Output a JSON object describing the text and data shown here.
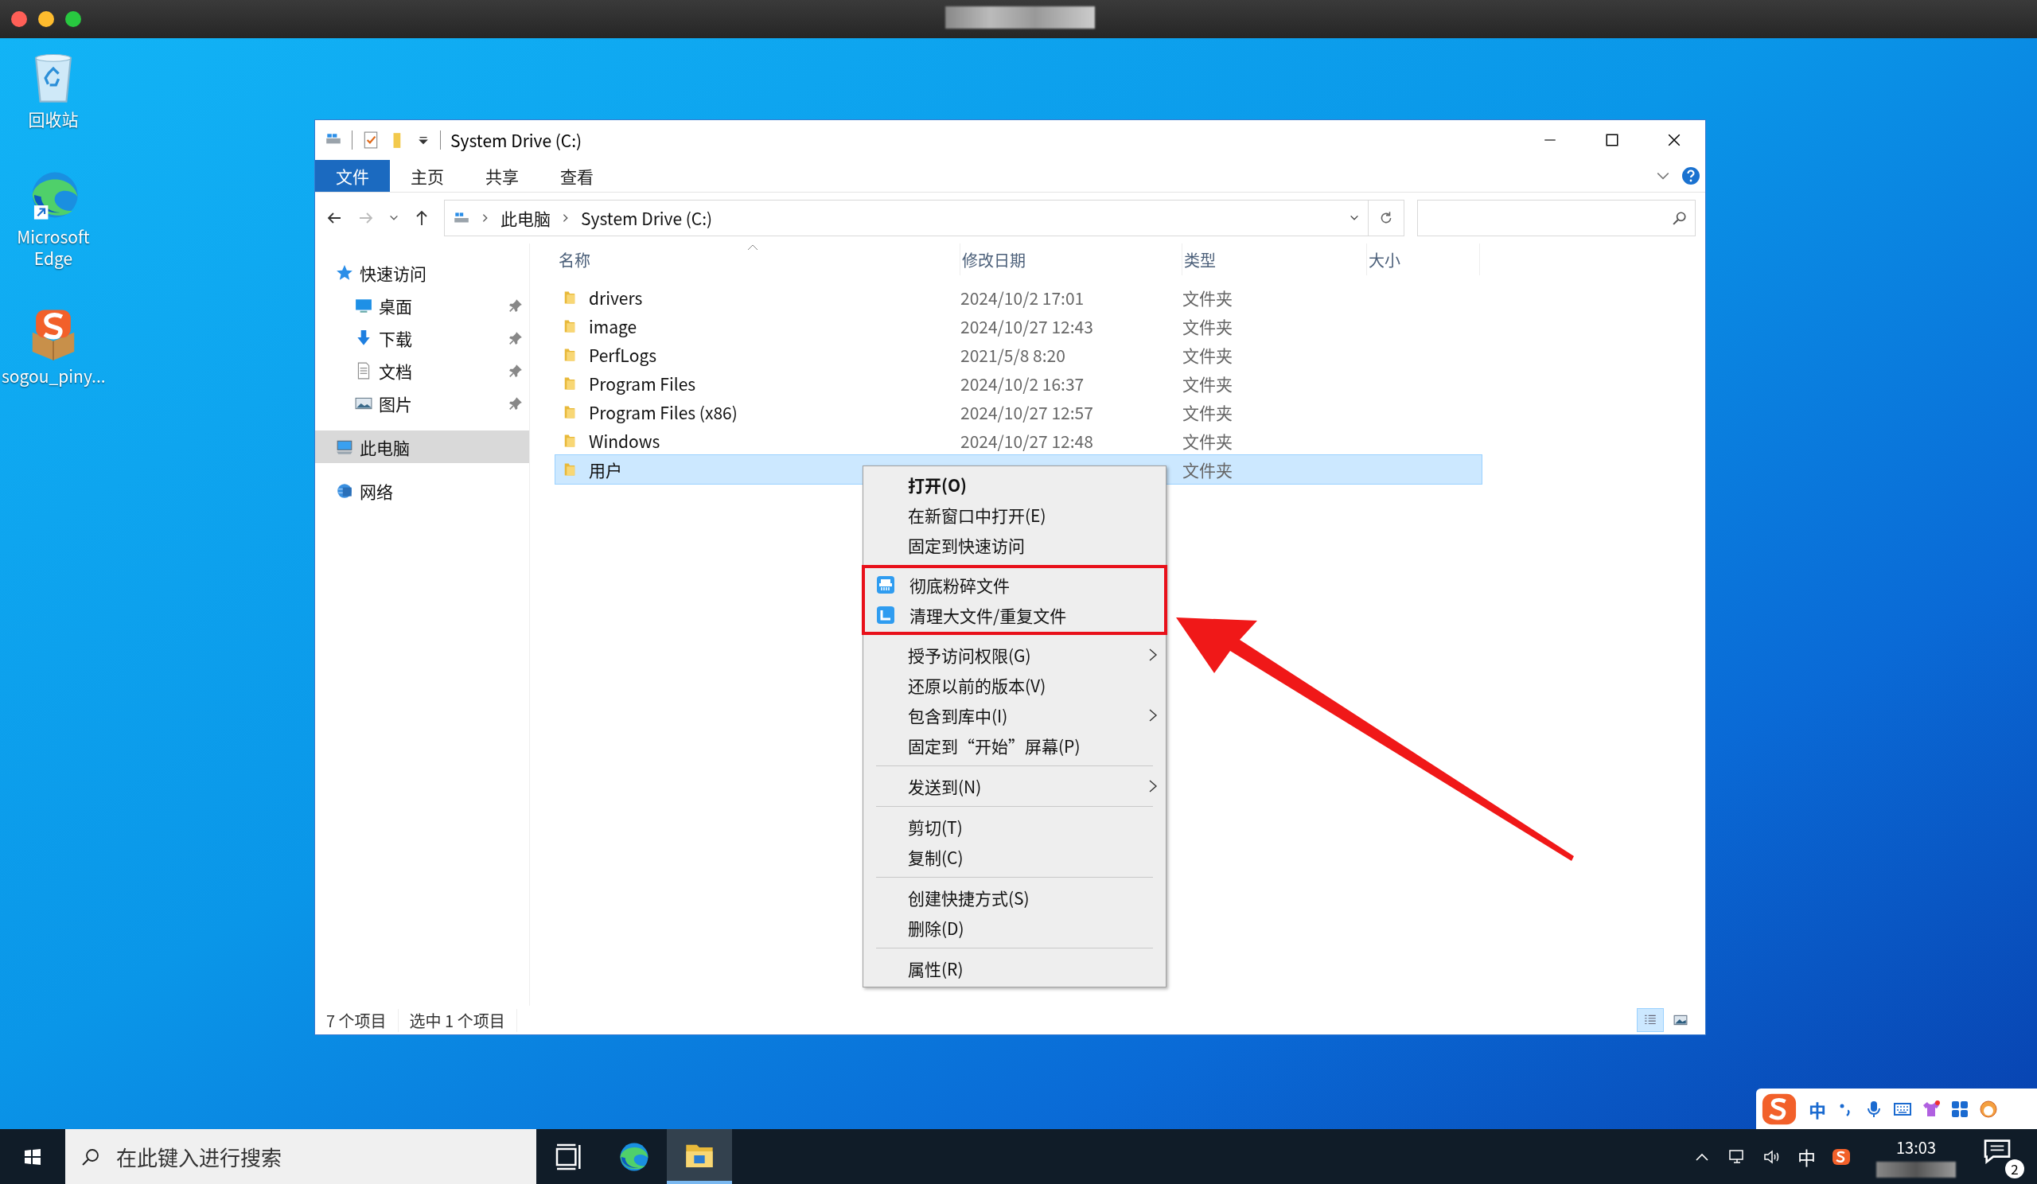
{
  "desktop_icons": [
    {
      "kind": "recycle_bin",
      "label": "回收站"
    },
    {
      "kind": "browser",
      "label": "Microsoft Edge"
    },
    {
      "kind": "ime",
      "label": "sogou_piny..."
    }
  ],
  "explorer": {
    "title": "System Drive (C:)",
    "ribbon_tabs": [
      {
        "label": "文件",
        "selected": true
      },
      {
        "label": "主页",
        "selected": false
      },
      {
        "label": "共享",
        "selected": false
      },
      {
        "label": "查看",
        "selected": false
      }
    ],
    "breadcrumbs": [
      "此电脑",
      "System Drive (C:)"
    ],
    "sidebar": [
      {
        "label": "快速访问",
        "kind": "star",
        "selected": false,
        "children": [
          {
            "label": "桌面",
            "kind": "desktop",
            "pinned": true,
            "selected": false
          },
          {
            "label": "下载",
            "kind": "download",
            "pinned": true,
            "selected": false
          },
          {
            "label": "文档",
            "kind": "document",
            "pinned": true,
            "selected": false
          },
          {
            "label": "图片",
            "kind": "pictures",
            "pinned": true,
            "selected": false
          }
        ]
      },
      {
        "label": "此电脑",
        "kind": "pc",
        "selected": true
      },
      {
        "label": "网络",
        "kind": "network",
        "selected": false
      }
    ],
    "columns": [
      "名称",
      "修改日期",
      "类型",
      "大小"
    ],
    "rows": [
      {
        "name": "drivers",
        "modified": "2024/10/2 17:01",
        "type": "文件夹",
        "selected": false
      },
      {
        "name": "image",
        "modified": "2024/10/27 12:43",
        "type": "文件夹",
        "selected": false
      },
      {
        "name": "PerfLogs",
        "modified": "2021/5/8 8:20",
        "type": "文件夹",
        "selected": false
      },
      {
        "name": "Program Files",
        "modified": "2024/10/2 16:37",
        "type": "文件夹",
        "selected": false
      },
      {
        "name": "Program Files (x86)",
        "modified": "2024/10/27 12:57",
        "type": "文件夹",
        "selected": false
      },
      {
        "name": "Windows",
        "modified": "2024/10/27 12:48",
        "type": "文件夹",
        "selected": false
      },
      {
        "name": "用户",
        "type": "文件夹",
        "selected": true
      }
    ],
    "status": [
      "7 个项目",
      "选中 1 个项目"
    ],
    "views": [
      {
        "kind": "details",
        "selected": true
      },
      {
        "kind": "thumbnails",
        "selected": false
      }
    ]
  },
  "context_menu": {
    "groups": [
      {
        "highlighted": false,
        "items": [
          {
            "label": "打开(O)",
            "default": true,
            "submenu": false
          },
          {
            "label": "在新窗口中打开(E)",
            "default": false,
            "submenu": false
          },
          {
            "label": "固定到快速访问",
            "default": false,
            "submenu": false
          }
        ]
      },
      {
        "highlighted": true,
        "items": [
          {
            "label": "彻底粉碎文件",
            "kind": "shredder",
            "default": false,
            "submenu": false
          },
          {
            "label": "清理大文件/重复文件",
            "kind": "cleaner",
            "default": false,
            "submenu": false
          }
        ]
      },
      {
        "highlighted": false,
        "items": [
          {
            "label": "授予访问权限(G)",
            "default": false,
            "submenu": true
          },
          {
            "label": "还原以前的版本(V)",
            "default": false,
            "submenu": false
          },
          {
            "label": "包含到库中(I)",
            "default": false,
            "submenu": true
          },
          {
            "label": "固定到“开始”屏幕(P)",
            "default": false,
            "submenu": false
          }
        ]
      },
      {
        "highlighted": false,
        "items": [
          {
            "label": "发送到(N)",
            "default": false,
            "submenu": true
          }
        ]
      },
      {
        "highlighted": false,
        "items": [
          {
            "label": "剪切(T)",
            "default": false,
            "submenu": false
          },
          {
            "label": "复制(C)",
            "default": false,
            "submenu": false
          }
        ]
      },
      {
        "highlighted": false,
        "items": [
          {
            "label": "创建快捷方式(S)",
            "default": false,
            "submenu": false
          },
          {
            "label": "删除(D)",
            "default": false,
            "submenu": false
          }
        ]
      },
      {
        "highlighted": false,
        "items": [
          {
            "label": "属性(R)",
            "default": false,
            "submenu": false
          }
        ]
      }
    ]
  },
  "ime_bar": {
    "mode": "中"
  },
  "taskbar": {
    "search": {
      "placeholder": "在此键入进行搜索"
    },
    "apps": [
      {
        "kind": "task_view",
        "active": false
      },
      {
        "kind": "browser",
        "active": false
      },
      {
        "kind": "file_explorer",
        "active": true
      }
    ],
    "tray": {
      "input_mode": "中",
      "time": "13:03",
      "notifications": "2"
    }
  }
}
